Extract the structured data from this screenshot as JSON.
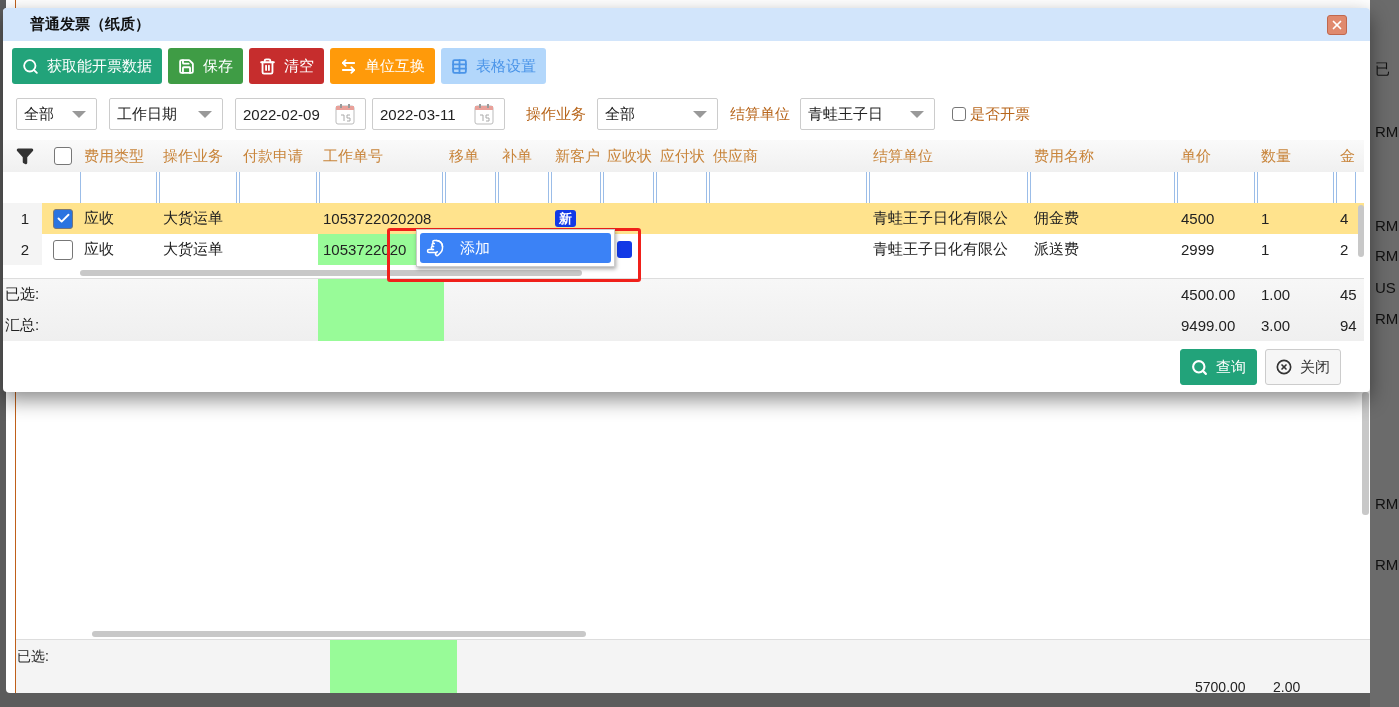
{
  "background_window": {
    "footer_label": "已选:",
    "footer_values": [
      "5700.00",
      "2.00"
    ],
    "side_column": [
      "已",
      "RM",
      "RM",
      "RM",
      "US",
      "RM",
      "RM",
      "RM"
    ]
  },
  "dialog": {
    "title": "普通发票（纸质）",
    "toolbar": [
      {
        "label": "获取能开票数据",
        "kind": "fetch",
        "disabled": false
      },
      {
        "label": "保存",
        "kind": "save",
        "disabled": false
      },
      {
        "label": "清空",
        "kind": "clear",
        "disabled": false
      },
      {
        "label": "单位互换",
        "kind": "swap",
        "disabled": false
      },
      {
        "label": "表格设置",
        "kind": "grid",
        "disabled": true
      }
    ],
    "filters": {
      "scope": "全部",
      "date_type": "工作日期",
      "date_from": "2022-02-09",
      "date_to": "2022-03-11",
      "business_label": "操作业务",
      "business": "全部",
      "settlement_label": "结算单位",
      "settlement": "青蛙王子日",
      "invoiced_label": "是否开票",
      "invoiced": false
    },
    "grid": {
      "all_checked": false,
      "columns": [
        {
          "label": "费用类型",
          "highlighted": false
        },
        {
          "label": "操作业务",
          "highlighted": false
        },
        {
          "label": "付款申请",
          "highlighted": false
        },
        {
          "label": "工作单号",
          "highlighted": true
        },
        {
          "label": "移单",
          "highlighted": false
        },
        {
          "label": "补单",
          "highlighted": false
        },
        {
          "label": "新客户",
          "highlighted": false
        },
        {
          "label": "应收状",
          "highlighted": false
        },
        {
          "label": "应付状",
          "highlighted": false
        },
        {
          "label": "供应商",
          "highlighted": false
        },
        {
          "label": "结算单位",
          "highlighted": false
        },
        {
          "label": "费用名称",
          "highlighted": false
        },
        {
          "label": "单价",
          "highlighted": false
        },
        {
          "label": "数量",
          "highlighted": false
        },
        {
          "label": "金",
          "highlighted": false
        }
      ],
      "rows": [
        {
          "number": "1",
          "checked": true,
          "selected": true,
          "fee_type": "应收",
          "business": "大货运单",
          "work_no": "1053722020208",
          "new_customer_badge": "新",
          "receivable_badge": false,
          "settlement": "青蛙王子日化有限公",
          "fee_name": "佣金费",
          "price": "4500",
          "qty": "1",
          "amount": "4"
        },
        {
          "number": "2",
          "checked": false,
          "selected": false,
          "fee_type": "应收",
          "business": "大货运单",
          "work_no": "1053722020",
          "receivable_badge": true,
          "settlement": "青蛙王子日化有限公",
          "fee_name": "派送费",
          "price": "2999",
          "qty": "1",
          "amount": "2"
        }
      ],
      "footer": [
        {
          "label": "已选:",
          "price": "4500.00",
          "qty": "1.00",
          "amount": "45"
        },
        {
          "label": "汇总:",
          "price": "9499.00",
          "qty": "3.00",
          "amount": "94"
        }
      ]
    },
    "context_menu": {
      "items": [
        {
          "label": "添加",
          "selected": true
        }
      ]
    },
    "actions": [
      {
        "label": "查询",
        "kind": "query"
      },
      {
        "label": "关闭",
        "kind": "close"
      }
    ]
  }
}
